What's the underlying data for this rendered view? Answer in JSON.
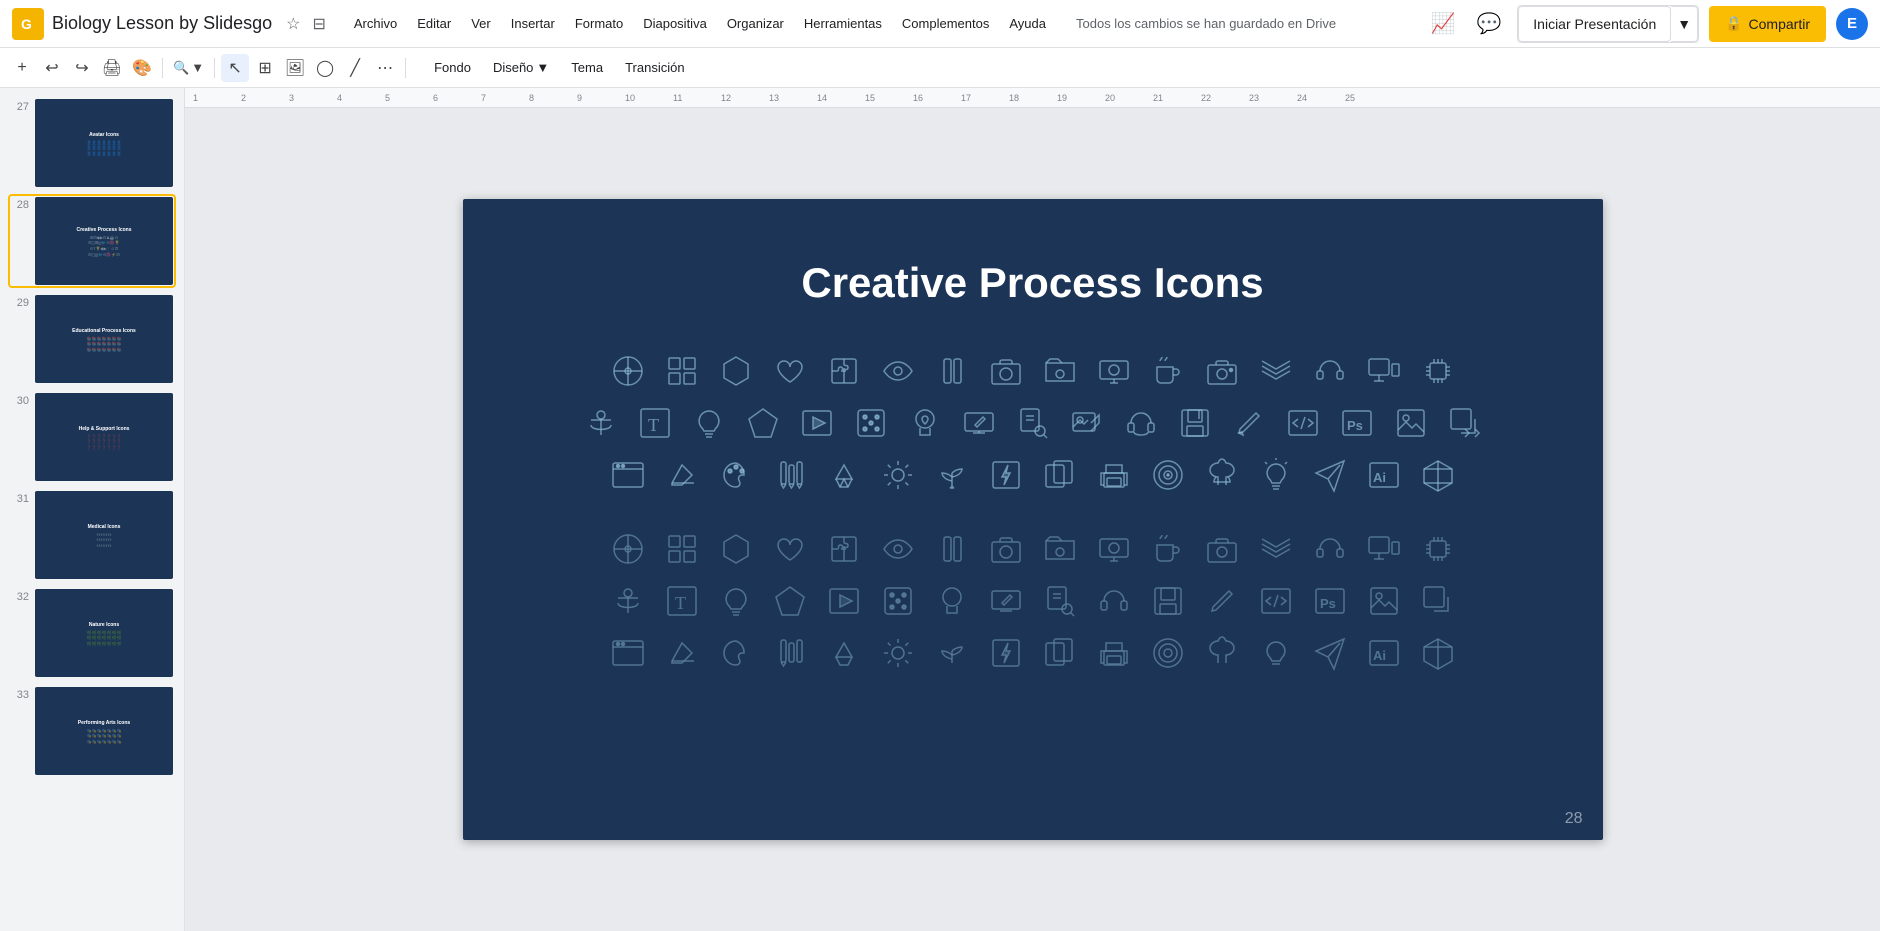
{
  "app": {
    "logo_letter": "G",
    "doc_title": "Biology Lesson by Slidesgo",
    "save_status": "Todos los cambios se han guardado en Drive"
  },
  "menu": {
    "items": [
      "Archivo",
      "Editar",
      "Ver",
      "Insertar",
      "Formato",
      "Diapositiva",
      "Organizar",
      "Herramientas",
      "Complementos",
      "Ayuda"
    ]
  },
  "topbar_right": {
    "present_label": "Iniciar Presentación",
    "share_label": "Compartir",
    "share_icon": "🔒",
    "user_initial": "E"
  },
  "toolbar": {
    "zoom_level": "▼",
    "fondo": "Fondo",
    "diseno": "Diseño",
    "diseno_arrow": "▼",
    "tema": "Tema",
    "transicion": "Transición"
  },
  "slides": [
    {
      "num": "27",
      "title": "Avatar Icons",
      "has_icons": true
    },
    {
      "num": "28",
      "title": "Creative Process Icons",
      "has_icons": true,
      "active": true
    },
    {
      "num": "29",
      "title": "Educational Process Icons",
      "has_icons": true
    },
    {
      "num": "30",
      "title": "Help & Support Icons",
      "has_icons": true
    },
    {
      "num": "31",
      "title": "Medical Icons",
      "has_icons": true
    },
    {
      "num": "32",
      "title": "Nature Icons",
      "has_icons": true
    },
    {
      "num": "33",
      "title": "Performing Arts Icons",
      "has_icons": true
    }
  ],
  "slide_28": {
    "title": "Creative Process Icons",
    "slide_number": "28",
    "icons_row1": [
      "⊿",
      "⊞",
      "⬡",
      "♡",
      "⊟",
      "◉",
      "▣",
      "⊡",
      "⊟",
      "⊡",
      "♟",
      "☕",
      "⊙",
      "≡",
      "⌘",
      "⊟",
      "⚙",
      ""
    ],
    "icons_row2": [
      "⚙",
      "T",
      "💡",
      "◆",
      "▶",
      "⋮⋮",
      "☺",
      "⊡",
      "⊕",
      "♪",
      "⊡",
      "✏",
      "</>",
      "Ps",
      "⊟",
      "⊠",
      ""
    ],
    "icons_row3": [
      "⊟",
      "◻",
      "⊞",
      "|||",
      "🐦",
      "⊙",
      "🌺",
      "⚡",
      "⊟",
      "◎",
      "🧠",
      "💡",
      "✈",
      "Ai",
      "⬡",
      ""
    ],
    "background_color": "#1c3557"
  }
}
